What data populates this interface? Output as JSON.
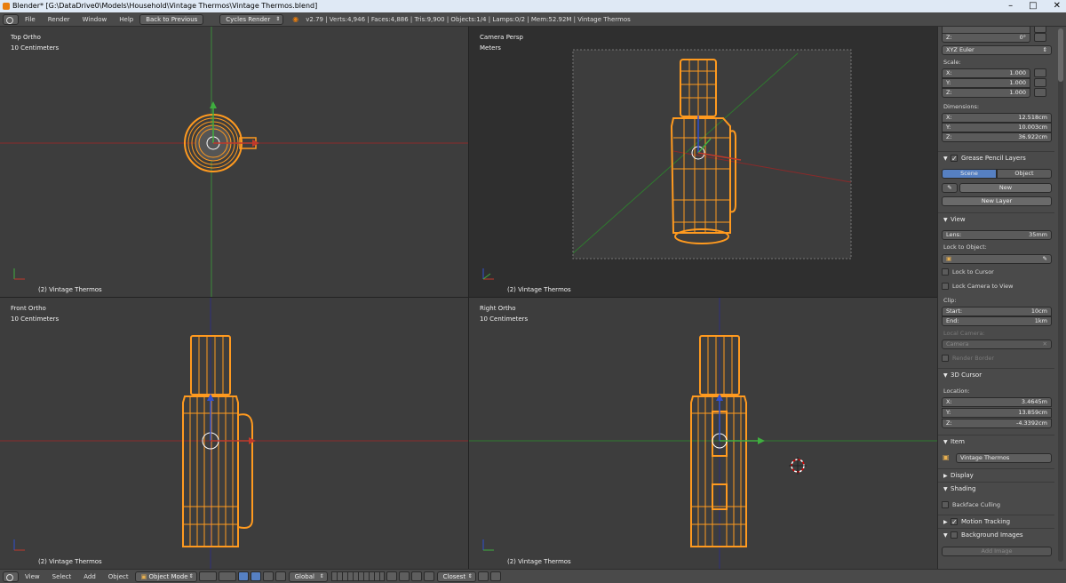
{
  "window": {
    "title": "Blender* [G:\\DataDrive0\\Models\\Household\\Vintage Thermos\\Vintage Thermos.blend]",
    "controls": [
      "–",
      "□",
      "✕"
    ]
  },
  "top_header": {
    "menus": [
      "File",
      "Render",
      "Window",
      "Help"
    ],
    "back_button": "Back to Previous",
    "render_engine": "Cycles Render",
    "stats": "v2.79 | Verts:4,946 | Faces:4,886 | Tris:9,900 | Objects:1/4 | Lamps:0/2 | Mem:52.92M | Vintage Thermos"
  },
  "viewports": [
    {
      "view": "Top Ortho",
      "scale": "10 Centimeters",
      "object": "(2) Vintage Thermos"
    },
    {
      "view": "Camera Persp",
      "scale": "Meters",
      "object": "(2) Vintage Thermos"
    },
    {
      "view": "Front Ortho",
      "scale": "10 Centimeters",
      "object": "(2) Vintage Thermos"
    },
    {
      "view": "Right Ortho",
      "scale": "10 Centimeters",
      "object": "(2) Vintage Thermos"
    }
  ],
  "properties": {
    "rotation_z": {
      "label": "Z:",
      "value": "0°"
    },
    "rotation_mode": "XYZ Euler",
    "scale_label": "Scale:",
    "scale": [
      {
        "label": "X:",
        "value": "1.000"
      },
      {
        "label": "Y:",
        "value": "1.000"
      },
      {
        "label": "Z:",
        "value": "1.000"
      }
    ],
    "dimensions_label": "Dimensions:",
    "dimensions": [
      {
        "label": "X:",
        "value": "12.518cm"
      },
      {
        "label": "Y:",
        "value": "10.003cm"
      },
      {
        "label": "Z:",
        "value": "36.922cm"
      }
    ],
    "grease_pencil": {
      "header": "Grease Pencil Layers",
      "tab_scene": "Scene",
      "tab_object": "Object",
      "new_button": "New",
      "new_layer_button": "New Layer"
    },
    "view": {
      "header": "View",
      "lens_label": "Lens:",
      "lens_value": "35mm",
      "lock_to_object_label": "Lock to Object:",
      "lock_to_cursor": "Lock to Cursor",
      "lock_camera_to_view": "Lock Camera to View",
      "clip_label": "Clip:",
      "clip_start_label": "Start:",
      "clip_start_value": "10cm",
      "clip_end_label": "End:",
      "clip_end_value": "1km",
      "local_camera_label": "Local Camera:",
      "local_camera_value": "Camera",
      "render_border": "Render Border"
    },
    "cursor_3d": {
      "header": "3D Cursor",
      "location_label": "Location:",
      "location": [
        {
          "label": "X:",
          "value": "3.4645m"
        },
        {
          "label": "Y:",
          "value": "13.859cm"
        },
        {
          "label": "Z:",
          "value": "-4.3392cm"
        }
      ]
    },
    "item": {
      "header": "Item",
      "name": "Vintage Thermos"
    },
    "display_header": "Display",
    "shading_header": "Shading",
    "backface_culling": "Backface Culling",
    "motion_tracking": "Motion Tracking",
    "background_images": "Background Images",
    "add_image": "Add Image"
  },
  "bottom_header": {
    "menus": [
      "View",
      "Select",
      "Add",
      "Object"
    ],
    "mode": "Object Mode",
    "orientation": "Global",
    "snap": "Closest"
  },
  "colors": {
    "wireframe": "#ff9a1f",
    "x_axis": "#c0392b",
    "y_axis": "#3fae3f",
    "z_axis": "#3050d0",
    "selected_tab": "#5680c2"
  }
}
